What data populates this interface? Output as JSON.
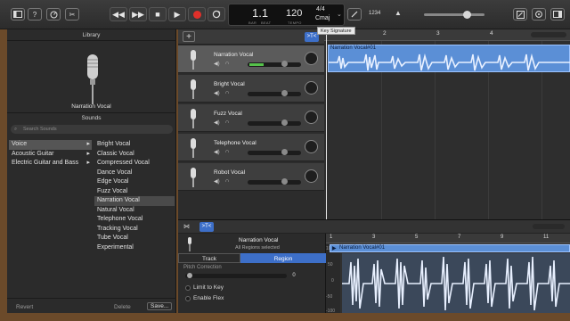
{
  "toolbar": {
    "lcd": {
      "position": "1.1",
      "position_labels": [
        "BAR",
        "BEAT"
      ],
      "tempo": "120",
      "tempo_label": "TEMPO",
      "signature": "4/4",
      "key": "Cmaj",
      "count_in": "1234"
    },
    "tooltip": "Key Signature",
    "icons": [
      "library-icon",
      "help-icon",
      "smart-controls-icon",
      "scissors-icon",
      "rewind-icon",
      "fast-forward-icon",
      "stop-icon",
      "play-icon",
      "record-icon",
      "cycle-icon",
      "tuner-icon",
      "count-in-icon",
      "master-volume-slider",
      "notepad-icon",
      "loop-browser-icon",
      "media-browser-icon"
    ],
    "accent": "#e0302a"
  },
  "library": {
    "title": "Library",
    "patch_name": "Narration Vocal",
    "sounds_title": "Sounds",
    "search_placeholder": "Search Sounds",
    "categories": [
      "Voice",
      "Acoustic Guitar",
      "Electric Guitar and Bass"
    ],
    "selected_category": "Voice",
    "patches": [
      "Bright Vocal",
      "Classic Vocal",
      "Compressed Vocal",
      "Dance Vocal",
      "Edge Vocal",
      "Fuzz Vocal",
      "Narration Vocal",
      "Natural Vocal",
      "Telephone Vocal",
      "Tracking Vocal",
      "Tube Vocal",
      "Experimental"
    ],
    "selected_patch": "Narration Vocal",
    "revert": "Revert",
    "delete": "Delete",
    "save": "Save..."
  },
  "tracks": [
    {
      "name": "Narration Vocal",
      "selected": true
    },
    {
      "name": "Bright Vocal",
      "selected": false
    },
    {
      "name": "Fuzz Vocal",
      "selected": false
    },
    {
      "name": "Telephone Vocal",
      "selected": false
    },
    {
      "name": "Robot Vocal",
      "selected": false
    }
  ],
  "arrange": {
    "ruler": [
      "2",
      "3",
      "4"
    ],
    "region_name": "Narration Vocal#01",
    "region_color": "#5b8fd6"
  },
  "editor": {
    "track_name": "Narration Vocal",
    "subtitle": "All Regions selected",
    "tab_track": "Track",
    "tab_region": "Region",
    "pitch_correction": "Pitch Correction",
    "pitch_value": "0",
    "limit_to_key": "Limit to Key",
    "enable_flex": "Enable Flex",
    "ruler": [
      "1",
      "3",
      "5",
      "7",
      "9",
      "11"
    ],
    "region_name": "Narration Vocal#01",
    "db_scale": [
      "100",
      "50",
      "0",
      "-50",
      "-100"
    ]
  }
}
